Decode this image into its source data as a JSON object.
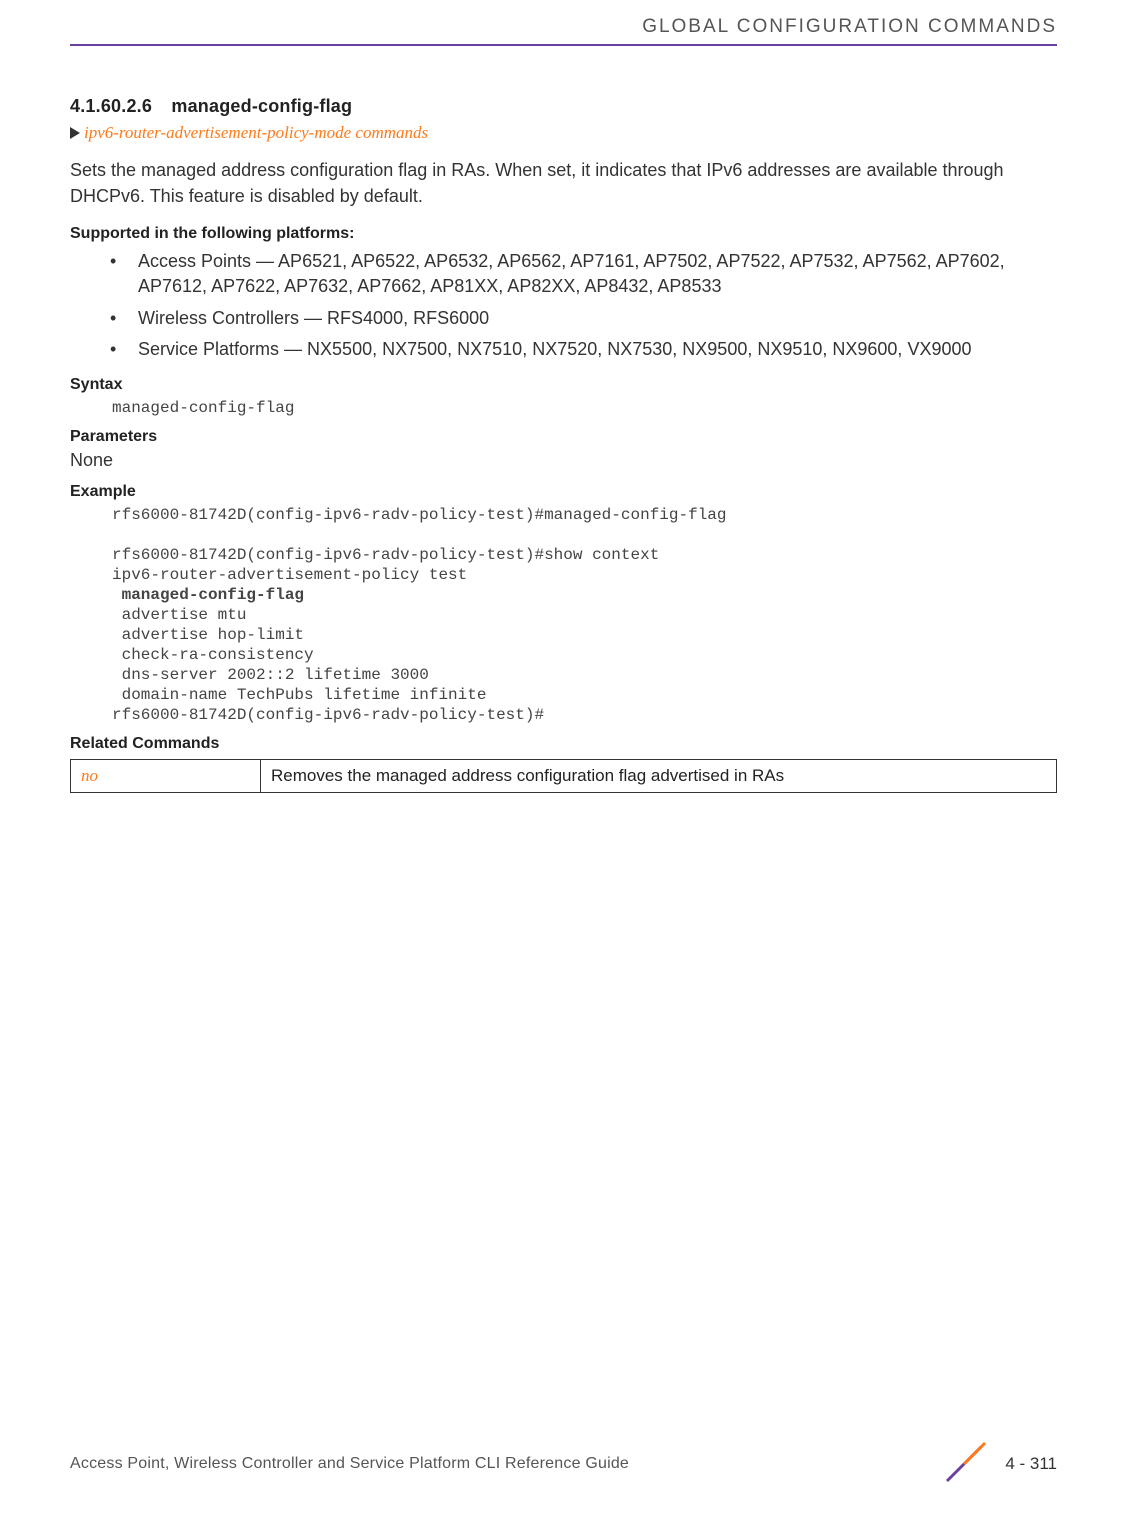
{
  "header": {
    "chapter_title": "GLOBAL CONFIGURATION COMMANDS"
  },
  "section": {
    "number": "4.1.60.2.6",
    "title": "managed-config-flag",
    "breadcrumb": "ipv6-router-advertisement-policy-mode commands",
    "description": "Sets the managed address configuration flag in RAs. When set, it indicates that IPv6 addresses are available through DHCPv6. This feature is disabled by default."
  },
  "supported": {
    "heading": "Supported in the following platforms:",
    "items": [
      "Access Points — AP6521, AP6522, AP6532, AP6562, AP7161, AP7502, AP7522, AP7532, AP7562, AP7602, AP7612, AP7622, AP7632, AP7662, AP81XX, AP82XX, AP8432, AP8533",
      "Wireless Controllers — RFS4000, RFS6000",
      "Service Platforms — NX5500, NX7500, NX7510, NX7520, NX7530, NX9500, NX9510, NX9600, VX9000"
    ]
  },
  "syntax": {
    "heading": "Syntax",
    "code": "managed-config-flag"
  },
  "parameters": {
    "heading": "Parameters",
    "value": "None"
  },
  "example": {
    "heading": "Example",
    "line1": "rfs6000-81742D(config-ipv6-radv-policy-test)#managed-config-flag",
    "blank1": "",
    "line2": "rfs6000-81742D(config-ipv6-radv-policy-test)#show context",
    "line3": "ipv6-router-advertisement-policy test",
    "line4": " managed-config-flag",
    "line5": " advertise mtu",
    "line6": " advertise hop-limit",
    "line7": " check-ra-consistency",
    "line8": " dns-server 2002::2 lifetime 3000",
    "line9": " domain-name TechPubs lifetime infinite",
    "line10": "rfs6000-81742D(config-ipv6-radv-policy-test)#"
  },
  "related": {
    "heading": "Related Commands",
    "rows": [
      {
        "cmd": "no",
        "desc": "Removes the managed address configuration flag advertised in RAs"
      }
    ]
  },
  "footer": {
    "doc_title": "Access Point, Wireless Controller and Service Platform CLI Reference Guide",
    "page": "4 - 311"
  }
}
